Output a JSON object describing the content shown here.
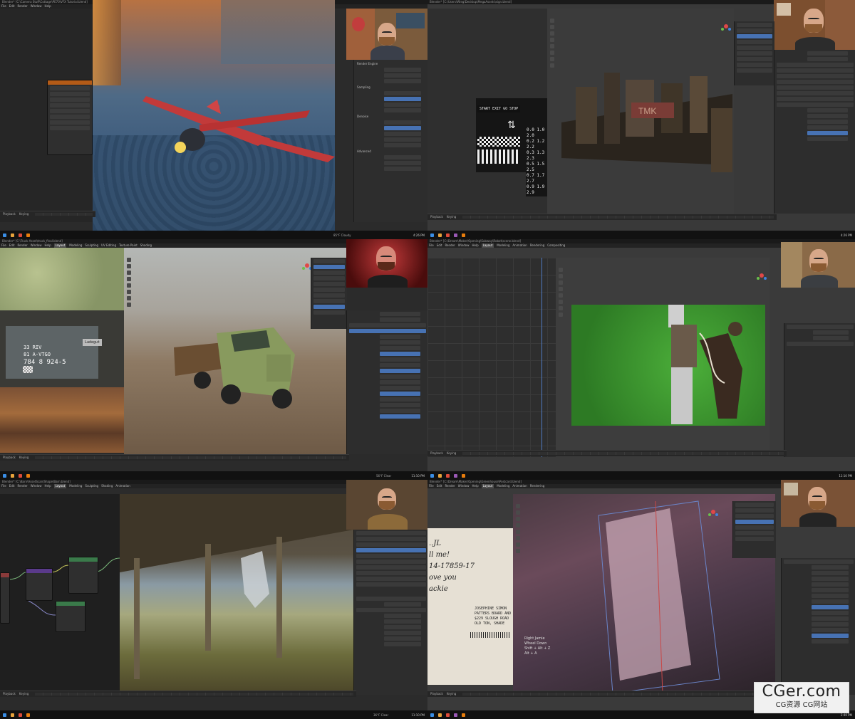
{
  "panels": {
    "p1": {
      "title": "Blender* [C:\\Camera Stuff\\Cottage\\PE70\\VFX Tutorial.blend]"
    },
    "p2": {
      "title": "Blender* [C:\\Users\\Wieg\\Desktop\\MegaAssets\\sign.blend]",
      "sign": {
        "row1": "START EXIT GO STOP",
        "nums": [
          "0.0 1.0 2.0",
          "0.2 1.2 2.2",
          "0.3 1.3 2.3",
          "0.5 1.5 2.5",
          "0.7 1.7 2.7",
          "0.9 1.9 2.9"
        ]
      },
      "tmk": "TMK"
    },
    "p3": {
      "title": "Blender* [C:\\Truck Asset\\truck_final.blend]",
      "plate": {
        "line1": "33 RIV",
        "line2": "81 A-VTGO",
        "line3": "784 8 924-5",
        "ladegut": "Ladegut"
      }
    },
    "p4": {
      "title": "Blender* [C:\\Dream\\Maker\\Opening\\Subway\\Robot\\scene.blend]"
    },
    "p5": {
      "title": "Blender* [C:\\Barn\\AssetScan\\Shape\\Barn.blend]"
    },
    "p6": {
      "title": "Blender* [C:\\Dream\\Maker\\Opening\\Greenhouse\\Postcard.blend]",
      "postcard": [
        "JOSEPHINE SIMON",
        "PATTERS BOARD AND",
        "$229 SLOUGH ROAD",
        "OLD TON, SHADE"
      ],
      "handwriting": [
        "..JL",
        "ll me!",
        "14-17859-17",
        "ove you",
        "ackie"
      ],
      "overlay": [
        "Right Jamie",
        "Wheel Down",
        "Shift + Alt + Z",
        "Alt + A"
      ]
    }
  },
  "menu": [
    "File",
    "Edit",
    "Render",
    "Window",
    "Help",
    "Layout",
    "Modeling",
    "Sculpting",
    "UV Editing",
    "Texture Paint",
    "Shading",
    "Animation",
    "Rendering",
    "Compositing",
    "Scripting"
  ],
  "taskbar": {
    "weather_a": "85°F Cloudy",
    "weather_b": "56°F Clear",
    "weather_c": "36°F Clear",
    "clock_a": "4:26 PM",
    "clock_b": "11:10 PM",
    "clock_c": "2:40 PM"
  },
  "watermark": {
    "main": "CGer.com",
    "sub": "CG资源  CG网站"
  }
}
